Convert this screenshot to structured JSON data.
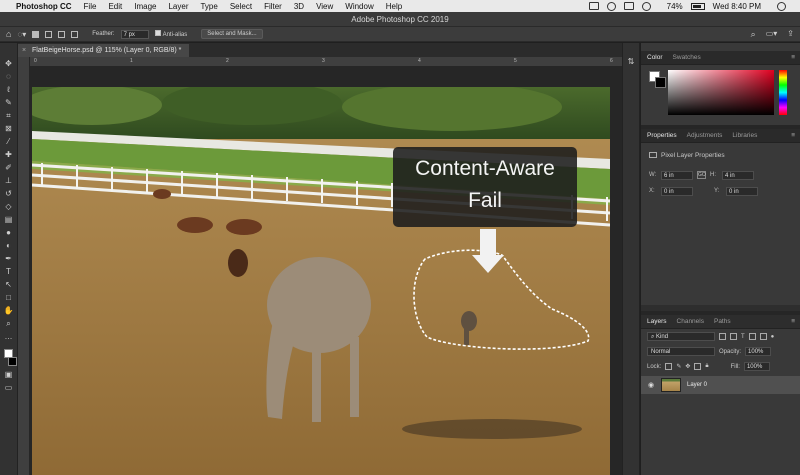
{
  "menubar": {
    "app": "Photoshop CC",
    "items": [
      "File",
      "Edit",
      "Image",
      "Layer",
      "Type",
      "Select",
      "Filter",
      "3D",
      "View",
      "Window",
      "Help"
    ],
    "battery": "74%",
    "clock": "Wed 8:40 PM"
  },
  "window": {
    "title": "Adobe Photoshop CC 2019"
  },
  "options": {
    "feather_label": "Feather:",
    "feather_value": "7 px",
    "antialias_label": "Anti-alias",
    "select_mask_label": "Select and Mask..."
  },
  "document": {
    "tab_label": "FlatBeigeHorse.psd @ 115% (Layer 0, RGB/8) *",
    "ruler_ticks": [
      "0",
      "1",
      "2",
      "3",
      "4",
      "5",
      "6"
    ]
  },
  "annotation": {
    "line1": "Content-Aware",
    "line2": "Fail"
  },
  "color_panel": {
    "tabs": [
      "Color",
      "Swatches"
    ]
  },
  "properties_panel": {
    "tabs": [
      "Properties",
      "Adjustments",
      "Libraries"
    ],
    "section": "Pixel Layer Properties",
    "w_label": "W:",
    "w_value": "6 in",
    "h_label": "H:",
    "h_value": "4 in",
    "x_label": "X:",
    "x_value": "0 in",
    "y_label": "Y:",
    "y_value": "0 in",
    "link_label": "GO"
  },
  "layers_panel": {
    "tabs": [
      "Layers",
      "Channels",
      "Paths"
    ],
    "filter_value": "Kind",
    "blend_mode": "Normal",
    "opacity_label": "Opacity:",
    "opacity_value": "100%",
    "lock_label": "Lock:",
    "fill_label": "Fill:",
    "fill_value": "100%",
    "layers": [
      {
        "name": "Layer 0",
        "visible": true
      }
    ]
  },
  "colors": {
    "accent": "#e00020",
    "panel": "#393939",
    "canvas": "#262626"
  }
}
